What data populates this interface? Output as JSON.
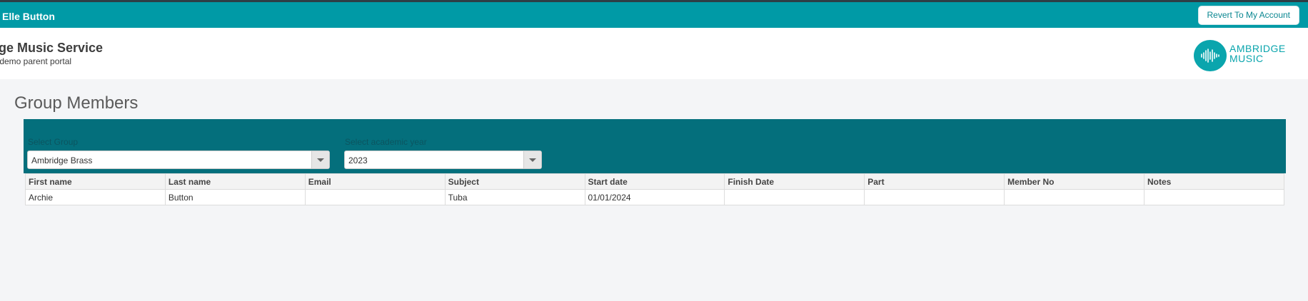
{
  "topbar": {
    "user_name": "Elle Button",
    "revert_button": "Revert To My Account",
    "color": "#009aa6"
  },
  "header": {
    "service_name": "idge Music Service",
    "portal_subtitle": "r demo parent portal",
    "logo": {
      "line1": "AMBRIDGE",
      "line2": "MUSIC",
      "icon": "soundwave-icon",
      "color": "#0aa5ad"
    }
  },
  "page": {
    "title": "Group Members"
  },
  "filters": {
    "panel_color": "#046f7c",
    "group": {
      "label": "Select Group",
      "value": "Ambridge Brass"
    },
    "academic_year": {
      "label": "Select academic year",
      "value": "2023"
    }
  },
  "table": {
    "columns": [
      "First name",
      "Last name",
      "Email",
      "Subject",
      "Start date",
      "Finish Date",
      "Part",
      "Member No",
      "Notes"
    ],
    "rows": [
      [
        "Archie",
        "Button",
        "",
        "Tuba",
        "01/01/2024",
        "",
        "",
        "",
        ""
      ]
    ]
  }
}
